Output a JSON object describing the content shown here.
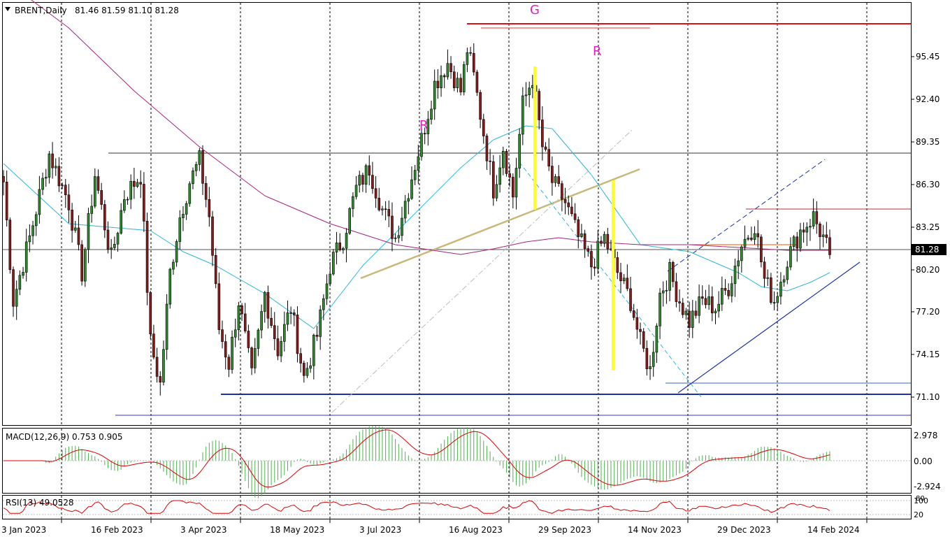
{
  "header": {
    "symbol_label": "BRENT,Daily",
    "ohlc": "81.46 81.59 81.10 81.28"
  },
  "macd": {
    "label": "MACD(12,26,9) 0.753 0.905",
    "axis": [
      "2.978",
      "0.00",
      "-2.924"
    ]
  },
  "rsi": {
    "label": "RSI(13) 49.0528",
    "axis": [
      "100",
      "80",
      "20"
    ]
  },
  "annotations": {
    "g_label": "G",
    "r_left_label": "R",
    "r_right_label": "R"
  },
  "current_price_label": "81.28",
  "chart_data": {
    "type": "candlestick",
    "x_labels": [
      "3 Jan 2023",
      "16 Feb 2023",
      "3 Apr 2023",
      "18 May 2023",
      "3 Jul 2023",
      "16 Aug 2023",
      "29 Sep 2023",
      "14 Nov 2023",
      "29 Dec 2023",
      "14 Feb 2024"
    ],
    "y_ticks": [
      "95.45",
      "92.40",
      "89.35",
      "86.30",
      "83.25",
      "80.20",
      "77.20",
      "74.15",
      "71.10"
    ],
    "ylim": [
      69.8,
      97.9
    ],
    "last_price": 81.28,
    "close_path": [
      [
        0,
        86.5
      ],
      [
        3,
        78.0
      ],
      [
        8,
        82.5
      ],
      [
        14,
        88.5
      ],
      [
        20,
        85.0
      ],
      [
        24,
        80.0
      ],
      [
        28,
        87.0
      ],
      [
        33,
        81.0
      ],
      [
        37,
        85.5
      ],
      [
        42,
        87.0
      ],
      [
        45,
        75.0
      ],
      [
        48,
        72.0
      ],
      [
        51,
        80.0
      ],
      [
        54,
        84.0
      ],
      [
        57,
        86.5
      ],
      [
        60,
        88.0
      ],
      [
        63,
        84.0
      ],
      [
        66,
        76.0
      ],
      [
        69,
        73.5
      ],
      [
        72,
        78.0
      ],
      [
        76,
        72.5
      ],
      [
        80,
        78.5
      ],
      [
        84,
        74.5
      ],
      [
        88,
        77.5
      ],
      [
        92,
        72.5
      ],
      [
        96,
        75.5
      ],
      [
        100,
        80.5
      ],
      [
        104,
        82.5
      ],
      [
        108,
        86.0
      ],
      [
        112,
        87.5
      ],
      [
        116,
        84.5
      ],
      [
        120,
        82.5
      ],
      [
        124,
        86.0
      ],
      [
        128,
        89.5
      ],
      [
        132,
        93.5
      ],
      [
        136,
        95.0
      ],
      [
        140,
        93.0
      ],
      [
        142,
        96.0
      ],
      [
        144,
        94.0
      ],
      [
        147,
        90.0
      ],
      [
        150,
        86.0
      ],
      [
        153,
        89.0
      ],
      [
        156,
        85.5
      ],
      [
        159,
        92.0
      ],
      [
        162,
        94.0
      ],
      [
        165,
        89.0
      ],
      [
        168,
        86.5
      ],
      [
        172,
        85.0
      ],
      [
        176,
        82.5
      ],
      [
        180,
        80.5
      ],
      [
        184,
        82.5
      ],
      [
        188,
        80.0
      ],
      [
        192,
        78.0
      ],
      [
        195,
        75.0
      ],
      [
        198,
        73.0
      ],
      [
        201,
        78.5
      ],
      [
        204,
        80.0
      ],
      [
        207,
        78.0
      ],
      [
        210,
        76.5
      ],
      [
        214,
        78.0
      ],
      [
        218,
        77.5
      ],
      [
        222,
        79.0
      ],
      [
        226,
        82.0
      ],
      [
        230,
        83.5
      ],
      [
        233,
        79.5
      ],
      [
        236,
        78.0
      ],
      [
        240,
        81.0
      ],
      [
        244,
        83.0
      ],
      [
        248,
        84.0
      ],
      [
        251,
        82.5
      ],
      [
        253,
        81.28
      ]
    ],
    "moving_averages": [
      {
        "name": "",
        "color": "#2ab7d6",
        "points": [
          [
            0,
            87.8
          ],
          [
            20,
            83.5
          ],
          [
            45,
            83.0
          ],
          [
            55,
            81.5
          ],
          [
            65,
            80.5
          ],
          [
            80,
            78.5
          ],
          [
            95,
            76.0
          ],
          [
            110,
            80.5
          ],
          [
            125,
            84.0
          ],
          [
            140,
            87.5
          ],
          [
            150,
            89.5
          ],
          [
            160,
            90.5
          ],
          [
            168,
            90.3
          ],
          [
            180,
            87.0
          ],
          [
            195,
            82.0
          ],
          [
            210,
            81.5
          ],
          [
            225,
            80.0
          ],
          [
            232,
            79.0
          ],
          [
            240,
            78.7
          ],
          [
            247,
            79.3
          ],
          [
            253,
            80.0
          ]
        ]
      },
      {
        "name": "",
        "color": "#a6247e",
        "points": [
          [
            0,
            101.0
          ],
          [
            20,
            97.5
          ],
          [
            40,
            93.0
          ],
          [
            60,
            89.0
          ],
          [
            80,
            85.5
          ],
          [
            100,
            83.5
          ],
          [
            120,
            82.0
          ],
          [
            140,
            81.3
          ],
          [
            150,
            81.7
          ],
          [
            160,
            82.2
          ],
          [
            170,
            82.5
          ],
          [
            180,
            82.2
          ],
          [
            195,
            82.0
          ],
          [
            210,
            82.0
          ],
          [
            225,
            81.8
          ],
          [
            240,
            81.6
          ],
          [
            253,
            81.6
          ]
        ]
      }
    ]
  }
}
